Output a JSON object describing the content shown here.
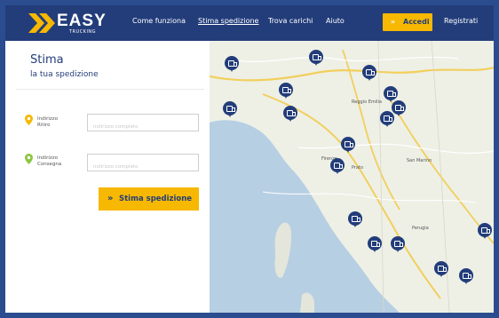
{
  "header": {
    "logo_text": "EASY",
    "logo_sub": "TRUCKING",
    "nav": [
      "Come funziona",
      "Stima spedizione",
      "Trova carichi",
      "Aiuto"
    ],
    "login_arrow": "»",
    "login_label": "Accedi",
    "register_label": "Registrati"
  },
  "form": {
    "title": "Stima",
    "subtitle": "la tua spedizione",
    "pickup": {
      "label_line1": "Indirizzo",
      "label_line2": "Ritiro",
      "placeholder": "Indirizzo completo"
    },
    "delivery": {
      "label_line1": "Indirizzo",
      "label_line2": "Consegna",
      "placeholder": "Indirizzo completo"
    },
    "submit_arrow": "»",
    "submit_label": "Stima spedizione"
  },
  "map": {
    "city_labels": [
      "Reggio Emilia",
      "Firenze",
      "San Marino",
      "Perugia",
      "Prato"
    ]
  },
  "colors": {
    "brand": "#233d7a",
    "accent": "#f6b800",
    "frame": "#2b4c8e"
  }
}
